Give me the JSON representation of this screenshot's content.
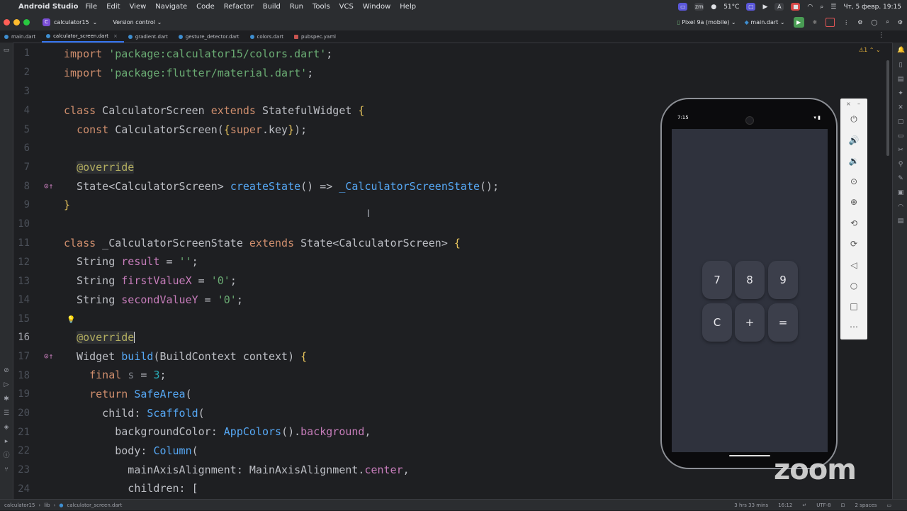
{
  "menubar": {
    "app_name": "Android Studio",
    "items": [
      "File",
      "Edit",
      "View",
      "Navigate",
      "Code",
      "Refactor",
      "Build",
      "Run",
      "Tools",
      "VCS",
      "Window",
      "Help"
    ],
    "temperature": "51°C",
    "clock": "Чт, 5 февр. 19:15"
  },
  "toolbar": {
    "project": "calculator15",
    "project_badge": "C",
    "vcs": "Version control",
    "device": "Pixel 9a (mobile)",
    "run_config": "main.dart"
  },
  "tabs": [
    {
      "label": "main.dart",
      "type": "dart",
      "active": false
    },
    {
      "label": "calculator_screen.dart",
      "type": "dart",
      "active": true
    },
    {
      "label": "gradient.dart",
      "type": "dart",
      "active": false
    },
    {
      "label": "gesture_detector.dart",
      "type": "dart",
      "active": false
    },
    {
      "label": "colors.dart",
      "type": "dart",
      "active": false
    },
    {
      "label": "pubspec.yaml",
      "type": "yaml",
      "active": false
    }
  ],
  "editor": {
    "line_numbers": [
      "1",
      "2",
      "3",
      "4",
      "5",
      "6",
      "7",
      "8",
      "9",
      "10",
      "11",
      "12",
      "13",
      "14",
      "15",
      "16",
      "17",
      "18",
      "19",
      "20",
      "21",
      "22",
      "23",
      "24"
    ],
    "current_line": "16",
    "warnings": "1"
  },
  "emulator": {
    "time": "7:15",
    "keys": [
      "7",
      "8",
      "9",
      "C",
      "+",
      "="
    ]
  },
  "statusbar": {
    "crumbs": [
      "calculator15",
      "lib",
      "calculator_screen.dart"
    ],
    "duration": "3 hrs 33 mins",
    "position": "16:12",
    "encoding": "UTF-8",
    "indent": "2 spaces"
  },
  "watermark": "zoom",
  "colors": {
    "accent": "#3574f0",
    "keyword": "#cf8e6d",
    "string": "#6aab73",
    "function": "#56a8f5",
    "field": "#c77dbb",
    "background": "#1e1f22"
  },
  "icons": [
    "apple-icon",
    "wifi-icon",
    "battery-icon",
    "search-icon",
    "run-icon",
    "stop-icon",
    "bulb-icon",
    "override-icon",
    "power-icon",
    "volume-up-icon",
    "volume-down-icon",
    "camera-icon",
    "zoom-in-icon",
    "rotate-icon",
    "back-icon",
    "home-icon",
    "overview-icon",
    "more-icon"
  ]
}
